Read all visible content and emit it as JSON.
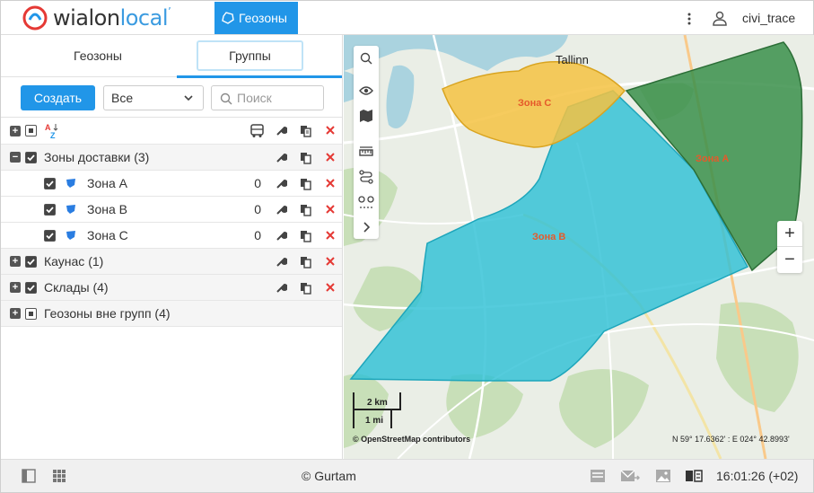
{
  "header": {
    "logo_word_1": "wialon",
    "logo_word_2": "local",
    "nav_tab_label": "Геозоны",
    "user_name": "civi_trace"
  },
  "tabs": [
    {
      "label": "Геозоны"
    },
    {
      "label": "Группы"
    }
  ],
  "toolbar": {
    "create_label": "Создать",
    "filter_value": "Все",
    "search_placeholder": "Поиск"
  },
  "groups": [
    {
      "name": "Зоны доставки (3)",
      "expanded": true,
      "children": [
        {
          "name": "Зона A",
          "count": "0",
          "color": "#2a7de1"
        },
        {
          "name": "Зона B",
          "count": "0",
          "color": "#2a7de1"
        },
        {
          "name": "Зона C",
          "count": "0",
          "color": "#2a7de1"
        }
      ]
    },
    {
      "name": "Каунас (1)"
    },
    {
      "name": "Склады (4)"
    },
    {
      "name": "Геозоны вне групп (4)"
    }
  ],
  "map": {
    "city_label": "Tallinn",
    "zones": [
      {
        "label": "Зона C",
        "color": "#f5c242"
      },
      {
        "label": "Зона A",
        "color": "#3a8f4a"
      },
      {
        "label": "Зона B",
        "color": "#2fc1d6"
      }
    ],
    "scale_km": "2 km",
    "scale_mi": "1 mi",
    "attribution": "© OpenStreetMap contributors",
    "coordinates": "N 59° 17.6362' : E 024° 42.8993'"
  },
  "footer": {
    "copyright": "© Gurtam",
    "time": "16:01:26 (+02)"
  },
  "colors": {
    "accent": "#2196e8",
    "delete": "#e53935"
  }
}
